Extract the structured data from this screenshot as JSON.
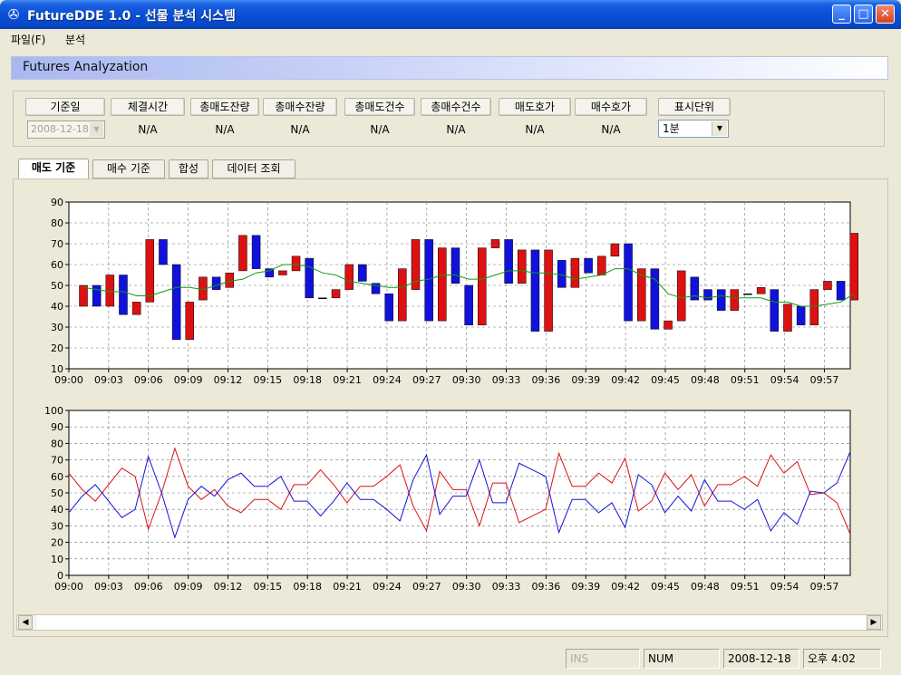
{
  "window": {
    "title": "FutureDDE 1.0 - 선물 분석 시스템",
    "min": "_",
    "max": "□",
    "close": "✕"
  },
  "menu": {
    "items": [
      "파일(F)",
      "분석"
    ]
  },
  "panel": {
    "title": "Futures Analyzation"
  },
  "controls": {
    "date_header": "기준일",
    "date_value": "2008-12-18",
    "columns": [
      {
        "header": "체결시간",
        "value": "N/A"
      },
      {
        "header": "총매도잔량",
        "value": "N/A"
      },
      {
        "header": "총매수잔량",
        "value": "N/A"
      },
      {
        "header": "총매도건수",
        "value": "N/A"
      },
      {
        "header": "총매수건수",
        "value": "N/A"
      },
      {
        "header": "매도호가",
        "value": "N/A"
      },
      {
        "header": "매수호가",
        "value": "N/A"
      }
    ],
    "unit_header": "표시단위",
    "unit_value": "1분"
  },
  "tabs": [
    "매도 기준",
    "매수 기준",
    "합성",
    "데이터 조회"
  ],
  "active_tab": 0,
  "colors": {
    "red": "#dd1111",
    "blue": "#1111dd",
    "ma": "#119911",
    "bg": "#ffffff"
  },
  "chart_data": [
    {
      "type": "candlestick",
      "x_tick_labels": [
        "09:00",
        "09:03",
        "09:06",
        "09:09",
        "09:12",
        "09:15",
        "09:18",
        "09:21",
        "09:24",
        "09:27",
        "09:30",
        "09:33",
        "09:36",
        "09:39",
        "09:42",
        "09:45",
        "09:48",
        "09:51",
        "09:54",
        "09:57"
      ],
      "ylim": [
        10,
        90
      ],
      "yticks": [
        10,
        20,
        30,
        40,
        50,
        60,
        70,
        80,
        90
      ],
      "grid": true,
      "bars": [
        {
          "t": "09:00",
          "open": 40,
          "close": 50
        },
        {
          "t": "09:01",
          "open": 50,
          "close": 40
        },
        {
          "t": "09:02",
          "open": 40,
          "close": 55
        },
        {
          "t": "09:03",
          "open": 55,
          "close": 36
        },
        {
          "t": "09:04",
          "open": 36,
          "close": 42
        },
        {
          "t": "09:05",
          "open": 42,
          "close": 72
        },
        {
          "t": "09:06",
          "open": 72,
          "close": 60
        },
        {
          "t": "09:07",
          "open": 60,
          "close": 24
        },
        {
          "t": "09:08",
          "open": 24,
          "close": 42
        },
        {
          "t": "09:09",
          "open": 43,
          "close": 54
        },
        {
          "t": "09:10",
          "open": 54,
          "close": 48
        },
        {
          "t": "09:11",
          "open": 49,
          "close": 56
        },
        {
          "t": "09:12",
          "open": 57,
          "close": 74
        },
        {
          "t": "09:13",
          "open": 74,
          "close": 58
        },
        {
          "t": "09:14",
          "open": 58,
          "close": 54
        },
        {
          "t": "09:15",
          "open": 55,
          "close": 57
        },
        {
          "t": "09:16",
          "open": 57,
          "close": 64
        },
        {
          "t": "09:17",
          "open": 63,
          "close": 44
        },
        {
          "t": "09:18",
          "open": 44,
          "close": 44
        },
        {
          "t": "09:19",
          "open": 44,
          "close": 48
        },
        {
          "t": "09:20",
          "open": 48,
          "close": 60
        },
        {
          "t": "09:21",
          "open": 60,
          "close": 52
        },
        {
          "t": "09:22",
          "open": 51,
          "close": 46
        },
        {
          "t": "09:23",
          "open": 46,
          "close": 33
        },
        {
          "t": "09:24",
          "open": 33,
          "close": 58
        },
        {
          "t": "09:25",
          "open": 48,
          "close": 72
        },
        {
          "t": "09:26",
          "open": 72,
          "close": 33
        },
        {
          "t": "09:27",
          "open": 33,
          "close": 68
        },
        {
          "t": "09:28",
          "open": 68,
          "close": 51
        },
        {
          "t": "09:29",
          "open": 50,
          "close": 31
        },
        {
          "t": "09:30",
          "open": 31,
          "close": 68
        },
        {
          "t": "09:31",
          "open": 68,
          "close": 72
        },
        {
          "t": "09:32",
          "open": 72,
          "close": 51
        },
        {
          "t": "09:33",
          "open": 51,
          "close": 67
        },
        {
          "t": "09:34",
          "open": 67,
          "close": 28
        },
        {
          "t": "09:35",
          "open": 28,
          "close": 67
        },
        {
          "t": "09:36",
          "open": 62,
          "close": 49
        },
        {
          "t": "09:37",
          "open": 49,
          "close": 63
        },
        {
          "t": "09:38",
          "open": 63,
          "close": 56
        },
        {
          "t": "09:39",
          "open": 55,
          "close": 64
        },
        {
          "t": "09:40",
          "open": 64,
          "close": 70
        },
        {
          "t": "09:41",
          "open": 70,
          "close": 33
        },
        {
          "t": "09:42",
          "open": 33,
          "close": 58
        },
        {
          "t": "09:43",
          "open": 58,
          "close": 29
        },
        {
          "t": "09:44",
          "open": 29,
          "close": 33
        },
        {
          "t": "09:45",
          "open": 33,
          "close": 57
        },
        {
          "t": "09:46",
          "open": 54,
          "close": 43
        },
        {
          "t": "09:47",
          "open": 48,
          "close": 43
        },
        {
          "t": "09:48",
          "open": 48,
          "close": 38
        },
        {
          "t": "09:49",
          "open": 38,
          "close": 48
        },
        {
          "t": "09:50",
          "open": 46,
          "close": 46
        },
        {
          "t": "09:51",
          "open": 46,
          "close": 49
        },
        {
          "t": "09:52",
          "open": 48,
          "close": 28
        },
        {
          "t": "09:53",
          "open": 28,
          "close": 41
        },
        {
          "t": "09:54",
          "open": 40,
          "close": 31
        },
        {
          "t": "09:55",
          "open": 31,
          "close": 48
        },
        {
          "t": "09:56",
          "open": 48,
          "close": 52
        },
        {
          "t": "09:57",
          "open": 52,
          "close": 43
        },
        {
          "t": "09:58",
          "open": 43,
          "close": 75
        }
      ],
      "ma": [
        49,
        48,
        47,
        47,
        45,
        45,
        47,
        49,
        49,
        48,
        50,
        52,
        53,
        56,
        57,
        60,
        60,
        59,
        56,
        55,
        52,
        51,
        50,
        49,
        49,
        52,
        53,
        55,
        55,
        53,
        53,
        55,
        57,
        57,
        56,
        56,
        55,
        53,
        54,
        55,
        58,
        58,
        55,
        53,
        46,
        44,
        45,
        44,
        45,
        44,
        44,
        44,
        42,
        42,
        40,
        40,
        41,
        42,
        46
      ],
      "ma_name": ""
    },
    {
      "type": "line",
      "x_tick_labels": [
        "09:00",
        "09:03",
        "09:06",
        "09:09",
        "09:12",
        "09:15",
        "09:18",
        "09:21",
        "09:24",
        "09:27",
        "09:30",
        "09:33",
        "09:36",
        "09:39",
        "09:42",
        "09:45",
        "09:48",
        "09:51",
        "09:54",
        "09:57"
      ],
      "ylim": [
        0,
        100
      ],
      "yticks": [
        0,
        10,
        20,
        30,
        40,
        50,
        60,
        70,
        80,
        90,
        100
      ],
      "grid": true,
      "series": [
        {
          "color": "red",
          "values": [
            62,
            52,
            45,
            55,
            65,
            60,
            28,
            50,
            77,
            54,
            46,
            52,
            42,
            38,
            46,
            46,
            40,
            55,
            55,
            64,
            55,
            44,
            54,
            54,
            60,
            67,
            42,
            27,
            63,
            52,
            52,
            30,
            56,
            56,
            32,
            36,
            40,
            74,
            54,
            54,
            62,
            56,
            71,
            39,
            45,
            62,
            52,
            61,
            42,
            55,
            55,
            60,
            54,
            73,
            62,
            69,
            49,
            50,
            44,
            25
          ]
        },
        {
          "color": "blue",
          "values": [
            38,
            48,
            55,
            45,
            35,
            40,
            72,
            50,
            23,
            46,
            54,
            48,
            58,
            62,
            54,
            54,
            60,
            45,
            45,
            36,
            45,
            56,
            46,
            46,
            40,
            33,
            58,
            73,
            37,
            48,
            48,
            70,
            44,
            44,
            68,
            64,
            60,
            26,
            46,
            46,
            38,
            44,
            29,
            61,
            55,
            38,
            48,
            39,
            58,
            45,
            45,
            40,
            46,
            27,
            38,
            31,
            51,
            50,
            56,
            75
          ]
        }
      ]
    }
  ],
  "scrollbar": {
    "left": "◀",
    "right": "▶"
  },
  "status": {
    "ins": "INS",
    "num": "NUM",
    "date": "2008-12-18",
    "time": "오후 4:02"
  }
}
